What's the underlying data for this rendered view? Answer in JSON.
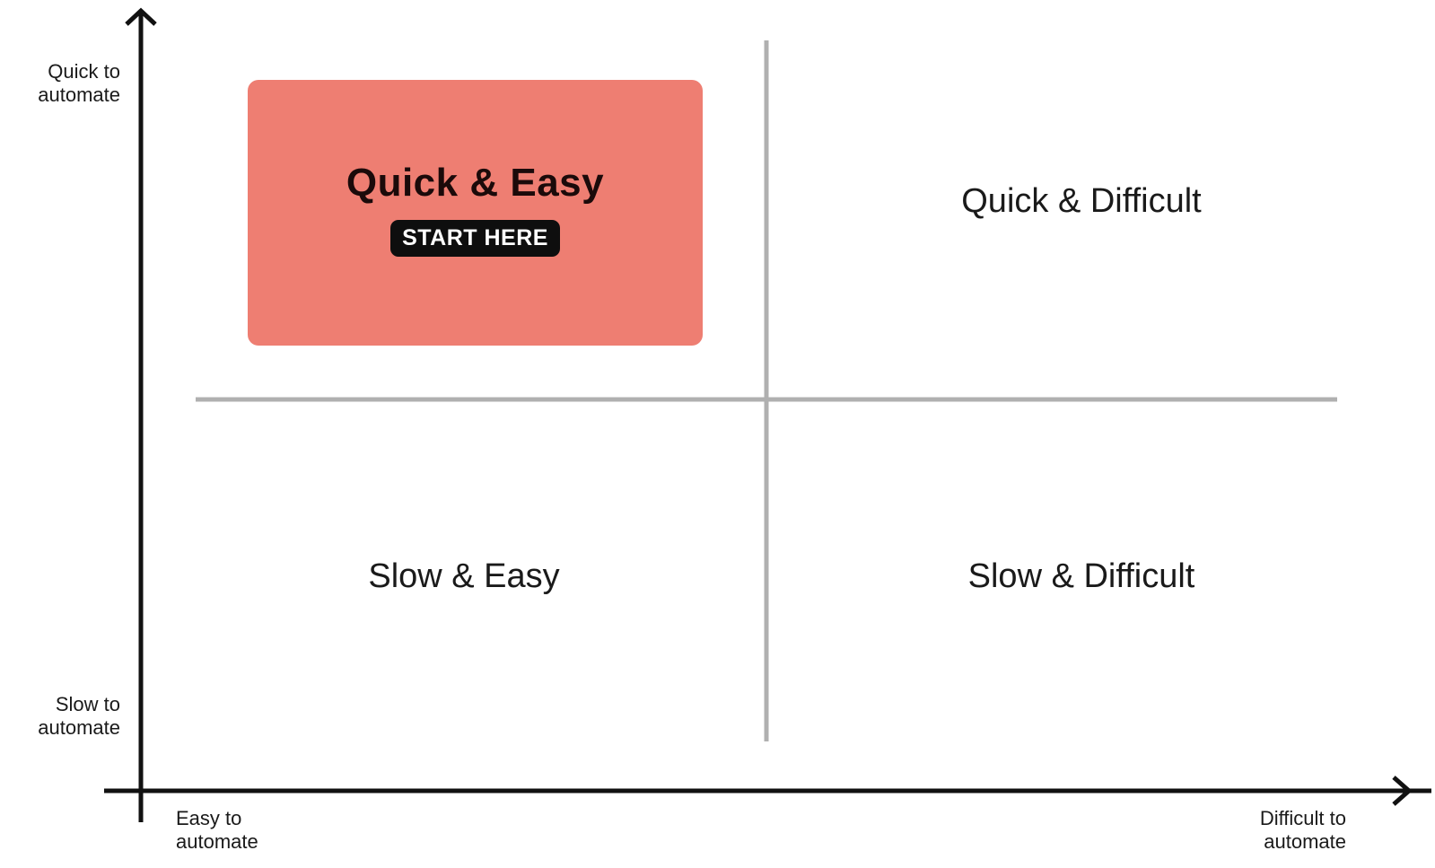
{
  "axes": {
    "y_top_label": "Quick to automate",
    "y_bottom_label": "Slow to automate",
    "x_left_label": "Easy to automate",
    "x_right_label": "Difficult to automate"
  },
  "quadrants": {
    "top_left": {
      "title": "Quick & Easy",
      "badge": "START HERE",
      "fill_color": "#ee7e72",
      "badge_color": "#0e0e0e"
    },
    "top_right": {
      "title": "Quick & Difficult"
    },
    "bottom_left": {
      "title": "Slow & Easy"
    },
    "bottom_right": {
      "title": "Slow & Difficult"
    }
  },
  "colors": {
    "axis": "#111111",
    "divider": "#b0b0b0"
  }
}
